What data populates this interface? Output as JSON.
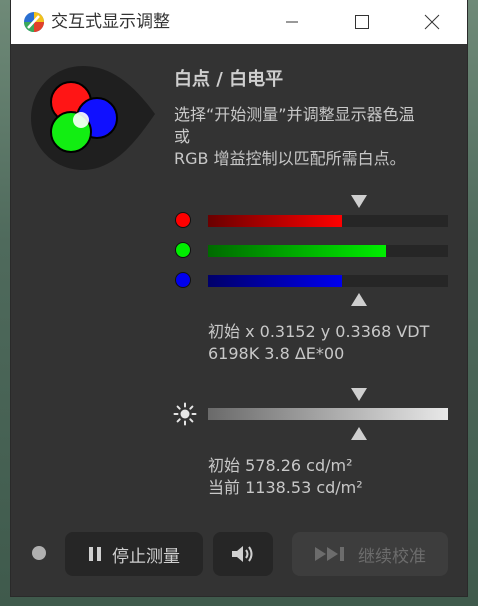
{
  "window": {
    "title": "交互式显示调整"
  },
  "heading": "白点 / 白电平",
  "description": [
    "选择“开始测量”并调整显示器色温",
    "或",
    "RGB 增益控制以匹配所需白点。"
  ],
  "rgb": {
    "red": {
      "level": 0.56,
      "color": "#ff0000"
    },
    "green": {
      "level": 0.74,
      "color": "#00ee00"
    },
    "blue": {
      "level": 0.56,
      "color": "#0000ee"
    }
  },
  "readout": {
    "line1": "初始 x 0.3152 y 0.3368 VDT",
    "line2": "6198K 3.8 ΔE*00"
  },
  "luminance": {
    "initial": "初始 578.26 cd/m²",
    "current": "当前 1138.53 cd/m²"
  },
  "buttons": {
    "stop": "停止测量",
    "continue": "继续校准"
  },
  "icons": {
    "app": "color-wheel-icon",
    "minimize": "minimize-icon",
    "maximize": "maximize-icon",
    "close": "close-icon",
    "brightness": "sun-icon",
    "pause": "pause-icon",
    "sound": "speaker-icon",
    "skip": "skip-forward-icon"
  }
}
